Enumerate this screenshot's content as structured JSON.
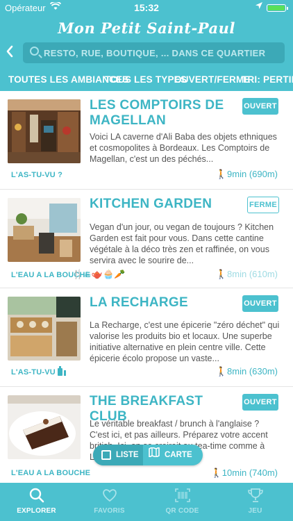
{
  "status": {
    "carrier": "Opérateur",
    "time": "15:32"
  },
  "app": {
    "title": "Mon Petit Saint-Paul"
  },
  "search": {
    "placeholder": "RESTO, RUE, BOUTIQUE, ... DANS CE QUARTIER"
  },
  "filters": [
    "TOUTES LES AMBIANCES",
    "TOUS LES TYPES",
    "OUVERT/FERME",
    "TRI: PERTINEN"
  ],
  "places": [
    {
      "name": "LES COMPTOIRS DE MAGELLAN",
      "status": "OUVERT",
      "description": "Voici LA caverne d'Ali Baba des objets ethniques et cosmopolites à Bordeaux.  Les Comptoirs de Magellan, c'est un des péchés...",
      "tag": "L'AS-TU-VU ?",
      "walk": "9min (690m)"
    },
    {
      "name": "KITCHEN GARDEN",
      "status": "FERME",
      "description": "Vegan d'un jour, ou vegan de toujours ? Kitchen Garden est fait pour vous. Dans cette cantine végétale à la déco très zen et raffinée, on vous servira avec le sourire de...",
      "tag": "L'EAU A LA BOUCHE",
      "walk": "8min (610m)"
    },
    {
      "name": "LA RECHARGE",
      "status": "OUVERT",
      "description": "La Recharge, c'est une épicerie \"zéro déchet\" qui valorise les produits bio et locaux. Une superbe initiative alternative en plein centre ville. Cette épicerie écolo propose un vaste...",
      "tag": "L'AS-TU-VU ?",
      "walk": "8min (630m)"
    },
    {
      "name": "THE BREAKFAST CLUB",
      "status": "OUVERT",
      "description": "Le véritable breakfast / brunch à l'anglaise ? C'est ici, et pas ailleurs.  Préparez votre accent british. Ici, on se croirait au tea-time comme à Londres. Vous...",
      "tag": "L'EAU A LA BOUCHE",
      "walk": "10min (740m)"
    }
  ],
  "view_toggle": {
    "list": "LISTE",
    "map": "CARTE"
  },
  "tabs": [
    {
      "label": "EXPLORER",
      "icon": "search-icon"
    },
    {
      "label": "FAVORIS",
      "icon": "heart-icon"
    },
    {
      "label": "QR CODE",
      "icon": "qr-code-icon"
    },
    {
      "label": "JEU",
      "icon": "trophy-icon"
    }
  ],
  "colors": {
    "accent": "#4cc1cf",
    "accent_dark": "#3ca9b7",
    "open_badge": "#4cc1cf"
  }
}
